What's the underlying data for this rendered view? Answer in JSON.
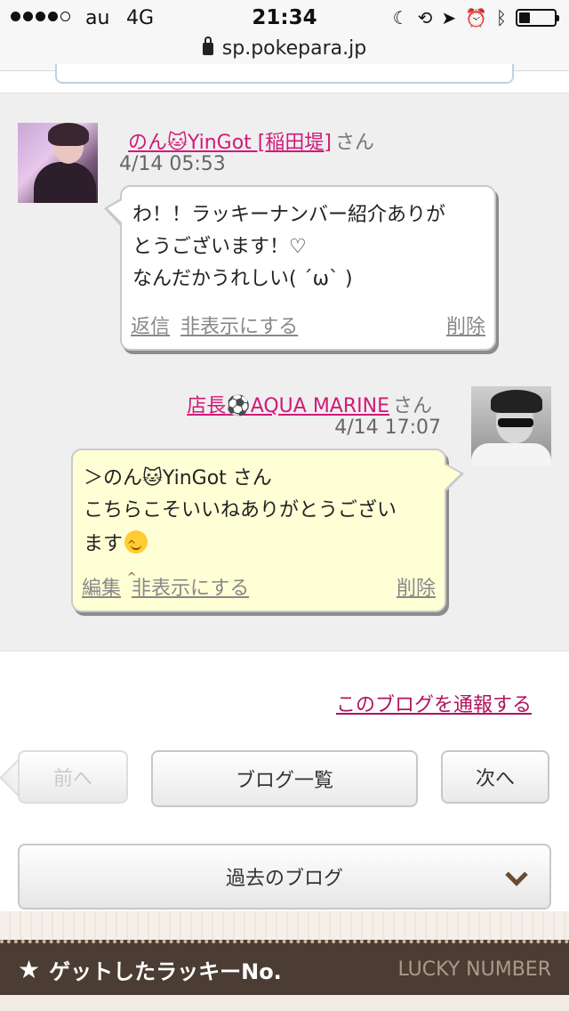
{
  "status_bar": {
    "carrier": "au",
    "network": "4G",
    "time": "21:34"
  },
  "browser": {
    "url": "sp.pokepara.jp"
  },
  "comments": [
    {
      "author_prefix": "のん",
      "author_suffix": "YinGot [稲田堤]",
      "honorific": "さん",
      "date": "4/14 05:53",
      "body_lines": [
        "わ！！ラッキーナンバー紹介ありが",
        "とうございます！♡",
        "なんだかうれしい( ˊωˋ )"
      ],
      "actions": {
        "reply": "返信",
        "hide": "非表示にする",
        "delete": "削除"
      }
    },
    {
      "author_prefix": "店長",
      "author_suffix": "AQUA MARINE",
      "honorific": "さん",
      "date": "4/14 17:07",
      "body_lines": [
        "＞のん🐱YinGot さん",
        "こちらこそいいねありがとうござい",
        "ます"
      ],
      "actions": {
        "edit": "編集",
        "hide": "非表示にする",
        "delete": "削除"
      }
    }
  ],
  "report_link": "このブログを通報する",
  "nav": {
    "prev": "前へ",
    "list": "ブログ一覧",
    "next": "次へ"
  },
  "past_blog": "過去のブログ",
  "lucky_bar": {
    "title": "ゲットしたラッキーNo.",
    "subtitle": "LUCKY NUMBER"
  },
  "colors": {
    "link": "#d11a79",
    "reply_bubble": "#ffffd6",
    "footer_bar": "#4b3d33"
  }
}
